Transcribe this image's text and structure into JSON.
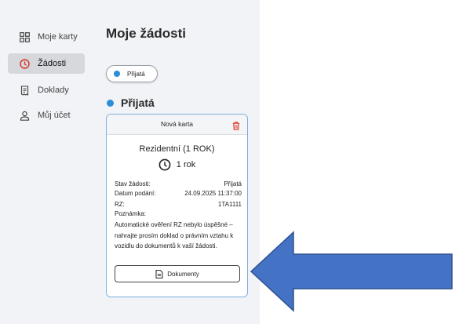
{
  "sidebar": {
    "items": [
      {
        "label": "Moje karty",
        "icon": "grid-icon",
        "active": false
      },
      {
        "label": "Žádosti",
        "icon": "clock-icon",
        "active": true
      },
      {
        "label": "Doklady",
        "icon": "receipt-icon",
        "active": false
      },
      {
        "label": "Můj účet",
        "icon": "person-icon",
        "active": false
      }
    ]
  },
  "main": {
    "title": "Moje žádosti",
    "filter_chip": "Přijatá",
    "section_title": "Přijatá",
    "card": {
      "header": "Nová karta",
      "name": "Rezidentní (1 ROK)",
      "duration": "1 rok",
      "rows": [
        {
          "label": "Stav žádosti:",
          "value": "Přijatá"
        },
        {
          "label": "Datum podání:",
          "value": "24.09.2025 11:37:00"
        },
        {
          "label": "RZ:",
          "value": "1TA1111"
        }
      ],
      "note_label": "Poznámka:",
      "note": "Automatické ověření RZ nebylo úspěšné – nahrajte prosím doklad o právním vztahu k vozidlu do dokumentů k vaší žádosti.",
      "documents_button": "Dokumenty"
    }
  },
  "colors": {
    "accent": "#2d8ed8",
    "active_icon": "#d93025",
    "arrow_fill": "#4472c4",
    "arrow_stroke": "#2f528f"
  }
}
